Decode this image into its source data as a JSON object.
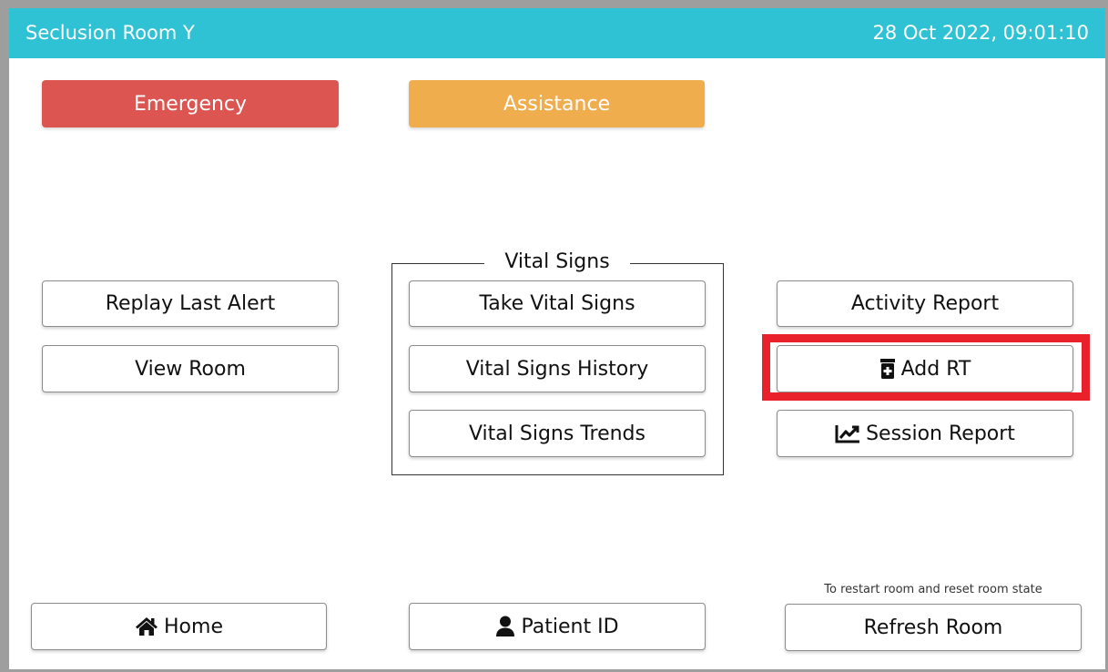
{
  "header": {
    "title": "Seclusion Room Y",
    "datetime": "28 Oct 2022, 09:01:10",
    "background": "#2fc1d4"
  },
  "alerts": {
    "emergency_label": "Emergency",
    "emergency_color": "#dc5550",
    "assistance_label": "Assistance",
    "assistance_color": "#f0ad4e"
  },
  "left_column": {
    "replay_label": "Replay Last Alert",
    "view_room_label": "View Room"
  },
  "vital_signs": {
    "legend": "Vital Signs",
    "take_label": "Take Vital Signs",
    "history_label": "Vital Signs History",
    "trends_label": "Vital Signs Trends"
  },
  "right_column": {
    "activity_report_label": "Activity Report",
    "add_rt_label": "Add RT",
    "add_rt_icon": "medicine-bottle-icon",
    "session_report_label": "Session Report",
    "session_report_icon": "chart-line-icon",
    "highlight_color": "#e8212a"
  },
  "footer": {
    "home_label": "Home",
    "home_icon": "home-icon",
    "patient_id_label": "Patient ID",
    "patient_id_icon": "user-icon",
    "refresh_note": "To restart room and reset room state",
    "refresh_label": "Refresh Room"
  }
}
